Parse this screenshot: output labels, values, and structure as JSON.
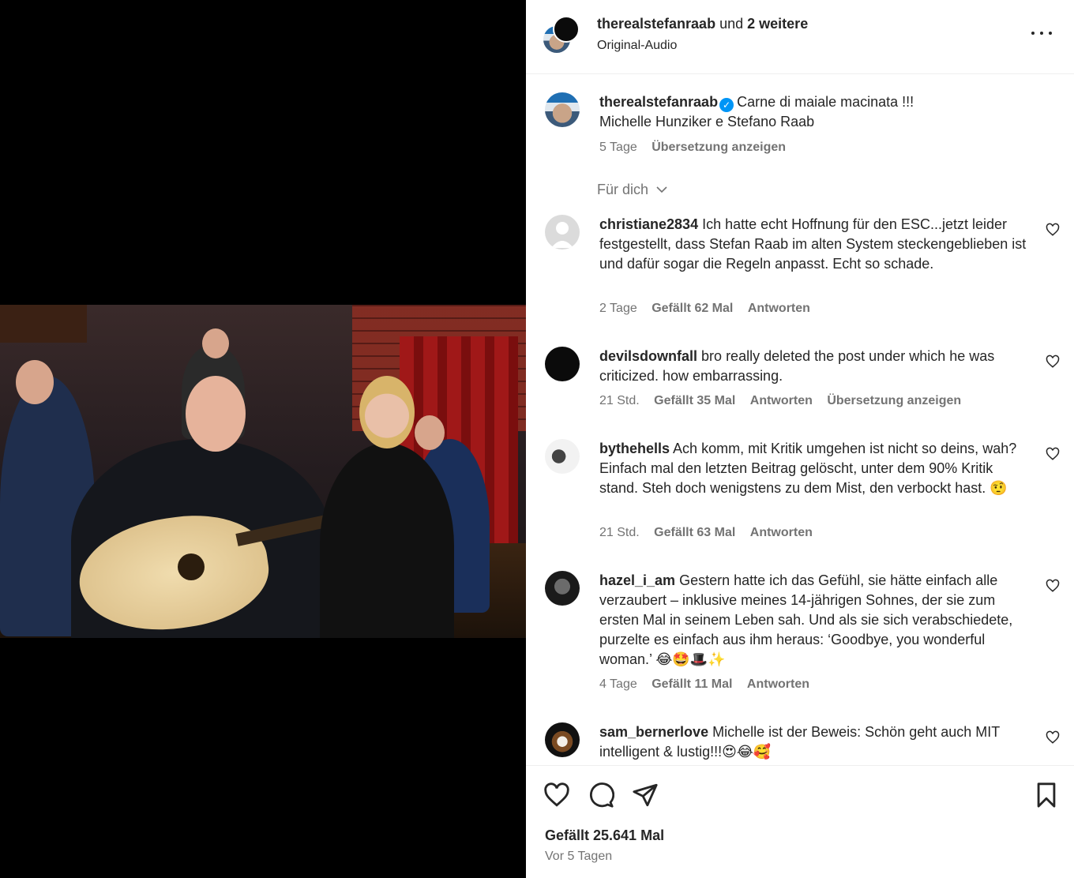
{
  "header": {
    "username": "therealstefanraab",
    "and_more": "und",
    "others": "2 weitere",
    "audio": "Original-Audio"
  },
  "caption": {
    "username": "therealstefanraab",
    "line1": "Carne di maiale macinata !!!",
    "line2": "Michelle Hunziker e Stefano Raab",
    "time": "5 Tage",
    "translate": "Übersetzung anzeigen"
  },
  "filter": {
    "label": "Für dich"
  },
  "comments": [
    {
      "username": "christiane2834",
      "text": "Ich hatte echt Hoffnung für den ESC...jetzt leider festgestellt, dass Stefan Raab im alten System steckengeblieben ist und dafür sogar die Regeln anpasst. Echt so schade.",
      "time": "2 Tage",
      "likes": "Gefällt 62 Mal",
      "reply": "Antworten",
      "translate": ""
    },
    {
      "username": "devilsdownfall",
      "text": "bro really deleted the post under which he was criticized. how embarrassing.",
      "time": "21 Std.",
      "likes": "Gefällt 35 Mal",
      "reply": "Antworten",
      "translate": "Übersetzung anzeigen"
    },
    {
      "username": "bythehells",
      "text": "Ach komm, mit Kritik umgehen ist nicht so deins, wah? Einfach mal den letzten Beitrag gelöscht, unter dem 90% Kritik stand. Steh doch wenigstens zu dem Mist, den verbockt hast. 🤨",
      "time": "21 Std.",
      "likes": "Gefällt 63 Mal",
      "reply": "Antworten",
      "translate": ""
    },
    {
      "username": "hazel_i_am",
      "text": "Gestern hatte ich das Gefühl, sie hätte einfach alle verzaubert – inklusive meines 14-jährigen Sohnes, der sie zum ersten Mal in seinem Leben sah. Und als sie sich verabschiedete, purzelte es einfach aus ihm heraus: ‘Goodbye, you wonderful woman.’ 😂🤩🎩✨",
      "time": "4 Tage",
      "likes": "Gefällt 11 Mal",
      "reply": "Antworten",
      "translate": ""
    },
    {
      "username": "sam_bernerlove",
      "text": "Michelle ist der Beweis: Schön geht auch MIT intelligent & lustig!!!😍😂🥰",
      "time": "",
      "likes": "",
      "reply": "",
      "translate": ""
    }
  ],
  "footer": {
    "likes": "Gefällt 25.641 Mal",
    "posted": "Vor 5 Tagen"
  },
  "icons": {
    "like": "heart-icon",
    "comment": "comment-icon",
    "share": "paper-plane-icon",
    "save": "bookmark-icon",
    "more": "more-horizontal-icon"
  }
}
